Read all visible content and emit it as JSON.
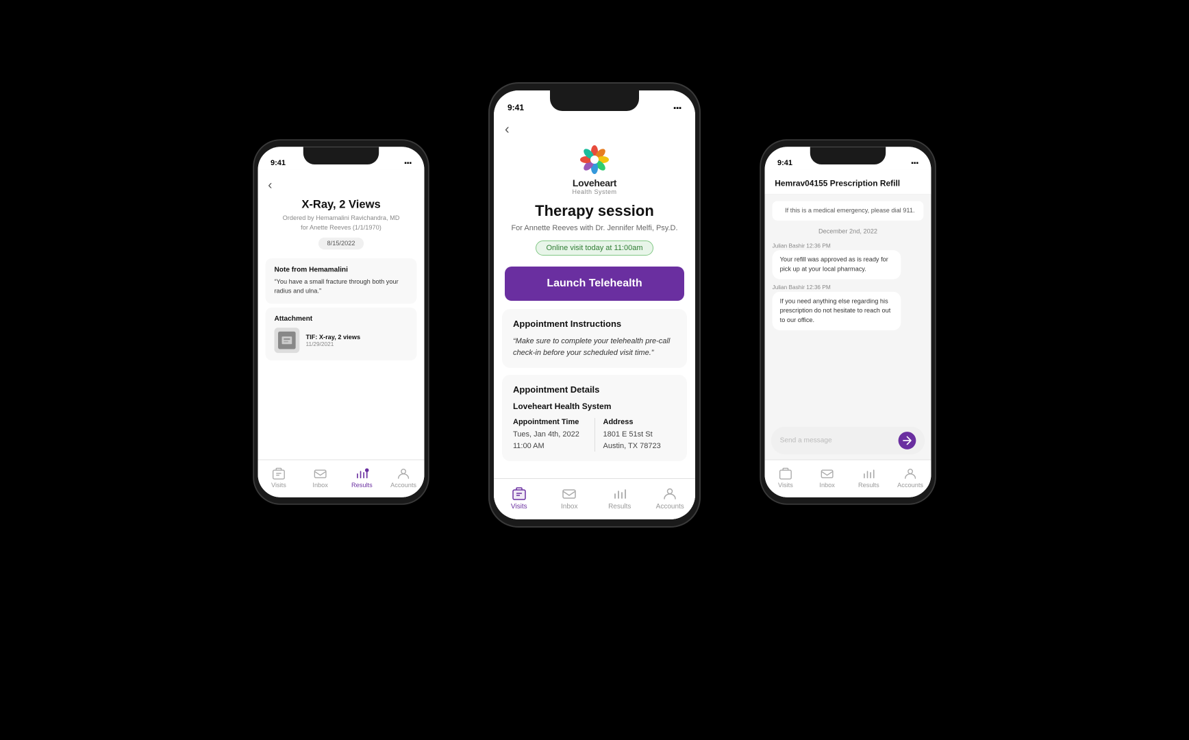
{
  "app": {
    "name": "Loveheart Health System",
    "logo_sub": "Health System"
  },
  "center_phone": {
    "screen_title": "Therapy session",
    "screen_subtitle": "For Annette Reeves with Dr. Jennifer Melfi, Psy.D.",
    "badge": "Online visit today at 11:00am",
    "launch_btn": "Launch Telehealth",
    "appointment_instructions_title": "Appointment Instructions",
    "appointment_instructions_quote": "“Make sure to complete your telehealth pre-call check-in before your scheduled visit time.”",
    "appointment_details_title": "Appointment Details",
    "org_name": "Loveheart Health System",
    "appt_time_label": "Appointment Time",
    "appt_time_value": "Tues, Jan 4th, 2022\n11:00 AM",
    "address_label": "Address",
    "address_value": "1801 E 51st St\nAustin, TX 78723"
  },
  "left_phone": {
    "title": "X-Ray, 2 Views",
    "ordered_by": "Ordered by Hemamalini Ravichandra, MD",
    "ordered_for": "for Anette Reeves (1/1/1970)",
    "date": "8/15/2022",
    "note_label": "Note from Hemamalini",
    "note_text": "“You have a small fracture through both your radius and ulna.”",
    "attachment_label": "Attachment",
    "attachment_name": "TIF: X-ray, 2 views",
    "attachment_date": "11/29/2021"
  },
  "right_phone": {
    "chat_title": "Hemrav04155 Prescription Refill",
    "emergency_msg": "If this is a medical emergency, please dial 911.",
    "date_separator": "December 2nd, 2022",
    "messages": [
      {
        "sender": "Julian Bashir 12:36 PM",
        "text": "Your refill was approved as is ready for pick up at your local pharmacy."
      },
      {
        "sender": "Julian Bashir 12:36 PM",
        "text": "If you need anything else regarding his prescription do not hesitate to reach out to our office."
      }
    ],
    "input_placeholder": "Send a message"
  },
  "nav": {
    "visits": "Visits",
    "inbox": "Inbox",
    "results": "Results",
    "accounts": "Accounts"
  }
}
